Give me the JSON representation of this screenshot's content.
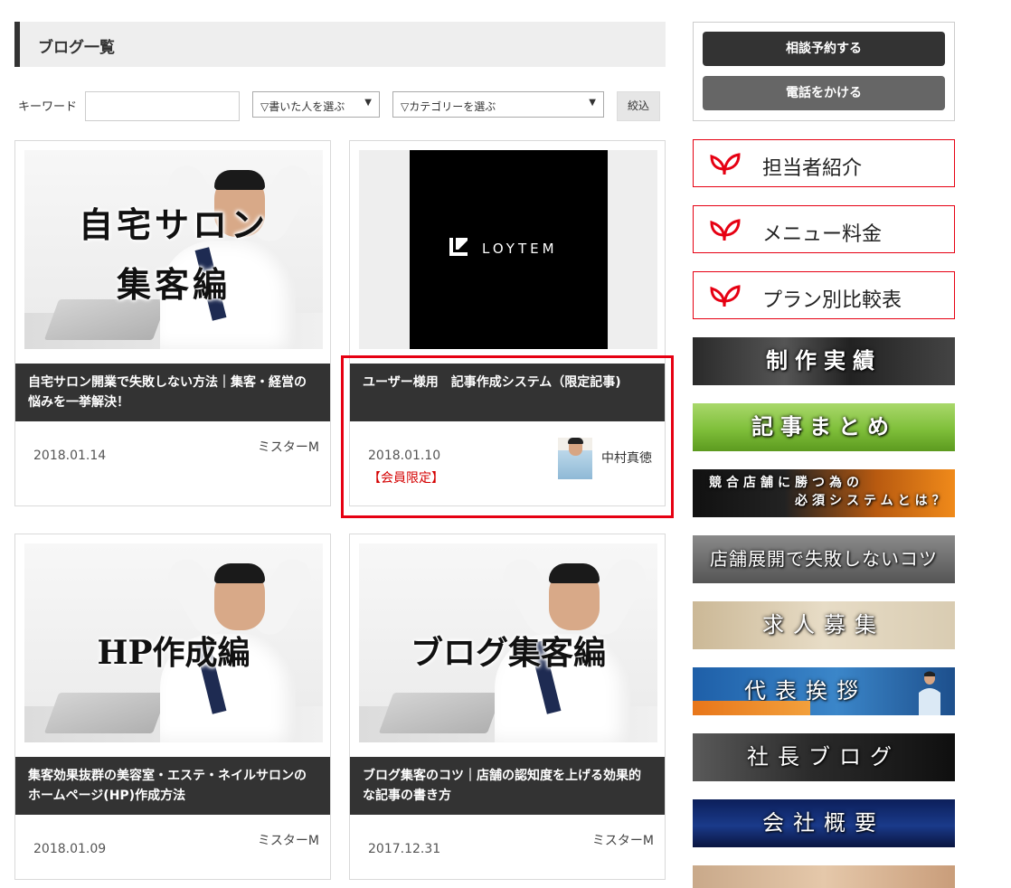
{
  "blog": {
    "heading": "ブログ一覧",
    "filter": {
      "keyword_label": "キーワード",
      "keyword_value": "",
      "author_select": "▽書いた人を選ぶ",
      "category_select": "▽カテゴリーを選ぶ",
      "select_caret": "▼",
      "submit": "絞込"
    },
    "posts": [
      {
        "image_text_line1": "自宅サロン",
        "image_text_line2": "集客編",
        "title": "自宅サロン開業で失敗しない方法｜集客・経営の悩みを一挙解決！",
        "date": "2018.01.14",
        "author": "ミスターM"
      },
      {
        "image_text": "LOYTEM",
        "title": "ユーザー様用　記事作成システム（限定記事)",
        "date": "2018.01.10",
        "badge": "【会員限定】",
        "author": "中村真徳"
      },
      {
        "image_text": "HP作成編",
        "title": "集客効果抜群の美容室・エステ・ネイルサロンのホームページ(HP)作成方法",
        "date": "2018.01.09",
        "author": "ミスターM"
      },
      {
        "image_text": "ブログ集客編",
        "title": "ブログ集客のコツ｜店舗の認知度を上げる効果的な記事の書き方",
        "date": "2017.12.31",
        "author": "ミスターM"
      }
    ]
  },
  "sidebar": {
    "cta": {
      "reserve": "相談予約する",
      "call": "電話をかける"
    },
    "links": [
      {
        "label": "担当者紹介"
      },
      {
        "label": "メニュー料金"
      },
      {
        "label": "プラン別比較表"
      }
    ],
    "banners": {
      "seisaku": "制作実績",
      "kiji": "記事まとめ",
      "kyougou_line1": "競合店舗に勝つ為の",
      "kyougou_line2": "必須システムとは？",
      "tenpo": "店舗展開で失敗しないコツ",
      "kyujin": "求人募集",
      "daihyo": "代表挨拶",
      "shacho": "社長ブログ",
      "kaisha": "会社概要"
    }
  },
  "colors": {
    "accent_red": "#e60012",
    "dark_bar": "#333333",
    "member_red": "#d40000"
  },
  "icons": {
    "side_link": "leaf-icon"
  }
}
